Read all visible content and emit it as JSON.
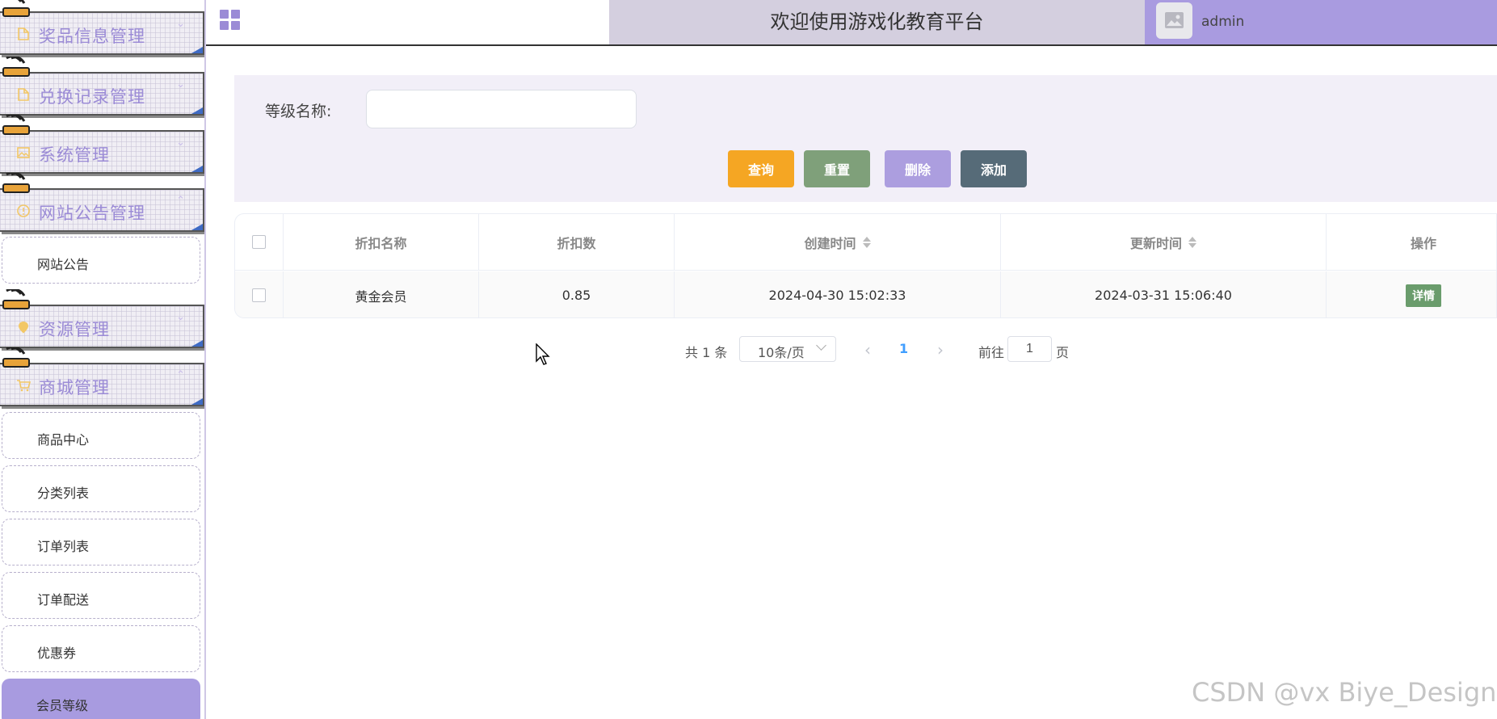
{
  "sidebar": {
    "groups": [
      {
        "label": "奖品信息管理",
        "icon": "document-icon"
      },
      {
        "label": "兑换记录管理",
        "icon": "document-icon"
      },
      {
        "label": "系统管理",
        "icon": "picture-icon"
      },
      {
        "label": "网站公告管理",
        "icon": "info-icon"
      },
      {
        "label": "资源管理",
        "icon": "location-icon"
      },
      {
        "label": "商城管理",
        "icon": "cart-icon"
      }
    ],
    "items": [
      {
        "label": "网站公告"
      },
      {
        "label": "商品中心"
      },
      {
        "label": "分类列表"
      },
      {
        "label": "订单列表"
      },
      {
        "label": "订单配送"
      },
      {
        "label": "优惠券"
      },
      {
        "label": "会员等级",
        "active": true
      }
    ]
  },
  "header": {
    "welcome": "欢迎使用游戏化教育平台",
    "username": "admin"
  },
  "search": {
    "label": "等级名称:",
    "value": "",
    "buttons": {
      "query": "查询",
      "reset": "重置",
      "delete": "删除",
      "add": "添加"
    }
  },
  "table": {
    "columns": [
      "折扣名称",
      "折扣数",
      "创建时间",
      "更新时间",
      "操作"
    ],
    "rows": [
      {
        "name": "黄金会员",
        "discount": "0.85",
        "created": "2024-04-30 15:02:33",
        "updated": "2024-03-31 15:06:40",
        "action": "详情"
      }
    ]
  },
  "pagination": {
    "total": "共 1 条",
    "page_size": "10条/页",
    "current_page": "1",
    "goto_label": "前往",
    "goto_value": "1",
    "goto_unit": "页"
  },
  "watermark": "CSDN @vx Biye_Design",
  "colors": {
    "accent_purple": "#a99be0",
    "query": "#f5a623",
    "reset": "#7fa07a",
    "delete": "#ac9edf",
    "add": "#566b78",
    "detail": "#6a9c6c"
  }
}
